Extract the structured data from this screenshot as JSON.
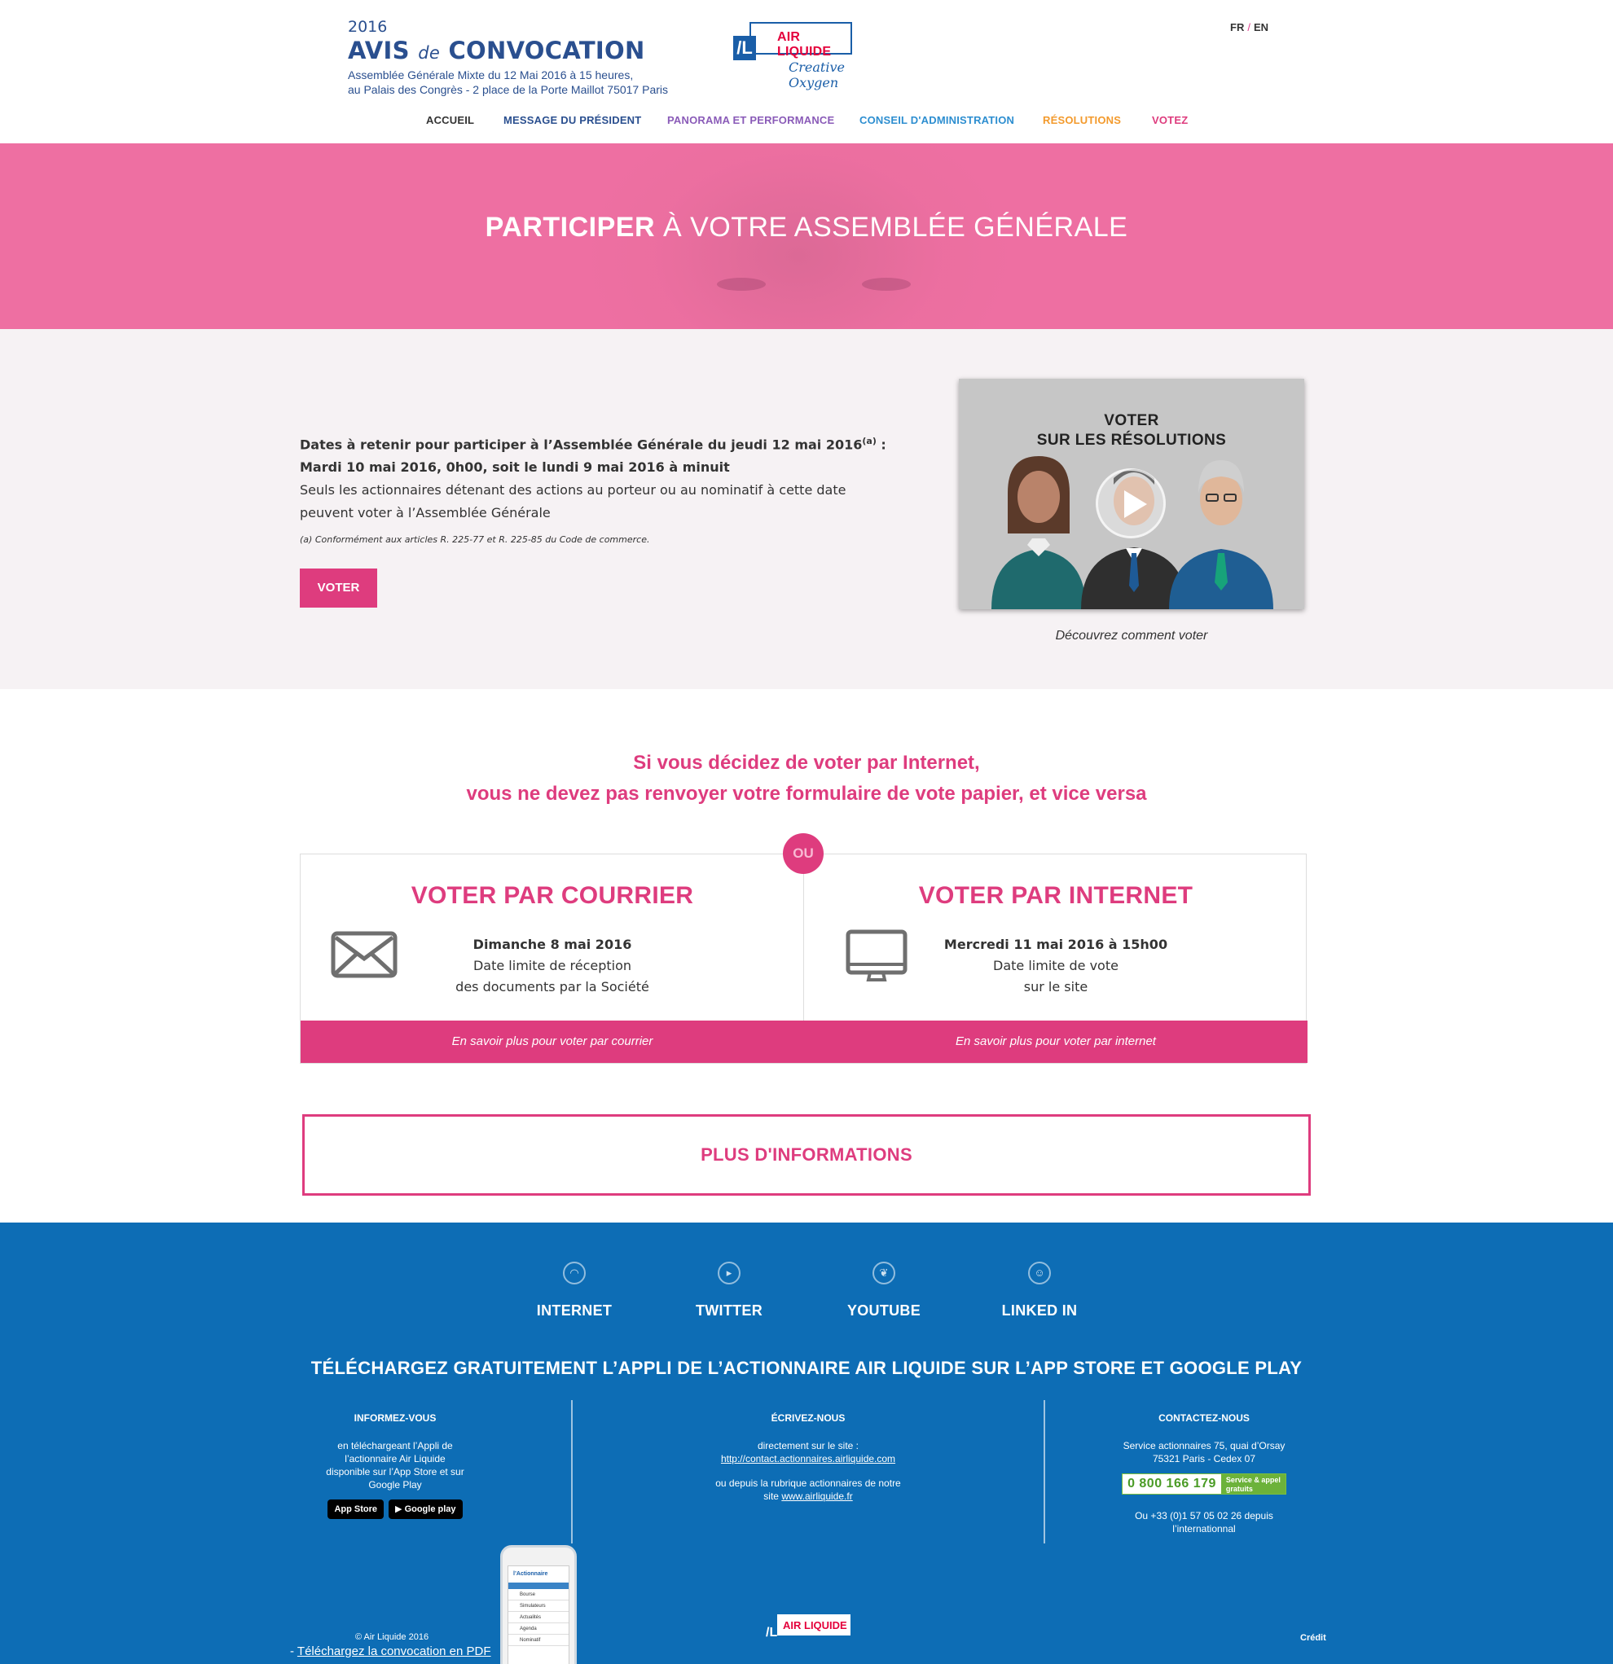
{
  "header": {
    "year": "2016",
    "title_main_1": "AVIS",
    "title_de": "de",
    "title_main_2": "CONVOCATION",
    "subtitle_1": "Assemblée Générale Mixte du 12 Mai 2016 à 15 heures,",
    "subtitle_2": "au Palais des Congrès - 2 place de la Porte Maillot 75017 Paris",
    "logo_name": "AIR LIQUIDE",
    "logo_tagline": "Creative Oxygen",
    "lang_fr": "FR",
    "lang_sep": "/",
    "lang_en": "EN"
  },
  "nav": [
    {
      "label": "ACCUEIL",
      "color": "#333333"
    },
    {
      "label": "MESSAGE DU PRÉSIDENT",
      "color": "#2a4f8f"
    },
    {
      "label": "PANORAMA ET PERFORMANCE",
      "color": "#8a5bb8"
    },
    {
      "label": "CONSEIL D'ADMINISTRATION",
      "color": "#2d8ed0"
    },
    {
      "label": "RÉSOLUTIONS",
      "color": "#f39a2c"
    },
    {
      "label": "VOTEZ",
      "color": "#de3c7e"
    }
  ],
  "hero": {
    "title_bold": "PARTICIPER",
    "title_rest": " À VOTRE ASSEMBLÉE GÉNÉRALE"
  },
  "info": {
    "line1": "Dates à retenir pour participer à l’Assemblée Générale du jeudi 12 mai 2016",
    "line1_sup": "(a)",
    "line1_end": " :",
    "line2": "Mardi 10 mai 2016, 0h00, soit le lundi 9 mai 2016 à minuit",
    "line3": "Seuls les actionnaires détenant des actions au porteur ou au nominatif à cette date peuvent voter à l’Assemblée Générale",
    "note": "(a) Conformément aux articles R. 225-77 et R. 225-85 du Code de commerce.",
    "button": "VOTER",
    "video_title_1": "VOTER",
    "video_title_2": "SUR LES RÉSOLUTIONS",
    "video_caption": "Découvrez comment voter"
  },
  "vote": {
    "heading_1": "Si vous décidez de voter par Internet,",
    "heading_2": "vous ne devez pas renvoyer votre formulaire de vote papier, et vice versa",
    "ou": "OU",
    "courrier": {
      "title": "VOTER PAR COURRIER",
      "date": "Dimanche 8 mai 2016",
      "desc_1": "Date limite de réception",
      "desc_2": "des documents par la Société",
      "link": "En savoir plus pour voter par courrier",
      "icon": "envelope-icon"
    },
    "internet": {
      "title": "VOTER PAR INTERNET",
      "date": "Mercredi 11 mai 2016 à 15h00",
      "desc_1": "Date limite de vote",
      "desc_2": "sur le site",
      "link": "En savoir plus pour voter par internet",
      "icon": "monitor-icon"
    },
    "more": "PLUS D'INFORMATIONS"
  },
  "footer": {
    "social": [
      {
        "label": "INTERNET",
        "icon": "wifi-icon"
      },
      {
        "label": "TWITTER",
        "icon": "play-icon"
      },
      {
        "label": "YOUTUBE",
        "icon": "leaf-icon"
      },
      {
        "label": "LINKED IN",
        "icon": "user-icon"
      }
    ],
    "app_title": "TÉLÉCHARGEZ GRATUITEMENT L’APPLI DE L’ACTIONNAIRE AIR LIQUIDE SUR L’APP STORE ET GOOGLE PLAY",
    "col1": {
      "title": "INFORMEZ-VOUS",
      "text_1": "en téléchargeant l’Appli de",
      "text_2": "l’actionnaire Air Liquide",
      "text_3": "disponible sur l’App Store et sur",
      "text_4": "Google Play",
      "badge_apple": "App Store",
      "badge_google": "Google play"
    },
    "col2": {
      "title": "ÉCRIVEZ-NOUS",
      "text_1": "directement sur le site :",
      "link_1": "http://contact.actionnaires.airliquide.com",
      "text_2": "ou depuis la rubrique actionnaires de notre",
      "text_3": "site",
      "link_2": "www.airliquide.fr"
    },
    "col3": {
      "title": "CONTACTEZ-NOUS",
      "text_1": "Service actionnaires 75, quai d’Orsay",
      "text_2": "75321 Paris - Cedex 07",
      "phone": "0 800 166 179",
      "phone_badge_1": "Service & appel",
      "phone_badge_2": "gratuits",
      "text_3": "Ou +33 (0)1 57 05 02 26 depuis",
      "text_4": "l’internationnal"
    },
    "app_screen_title": "l’Actionnaire",
    "app_menu": [
      "Bourse",
      "Simulateurs",
      "Actualités",
      "Agenda",
      "Nominatif"
    ],
    "logo_name": "AIR LIQUIDE",
    "copyright": "© Air Liquide 2016",
    "pdf_prefix": "- ",
    "pdf_link": "Téléchargez la convocation en PDF",
    "credit": "Crédit"
  }
}
